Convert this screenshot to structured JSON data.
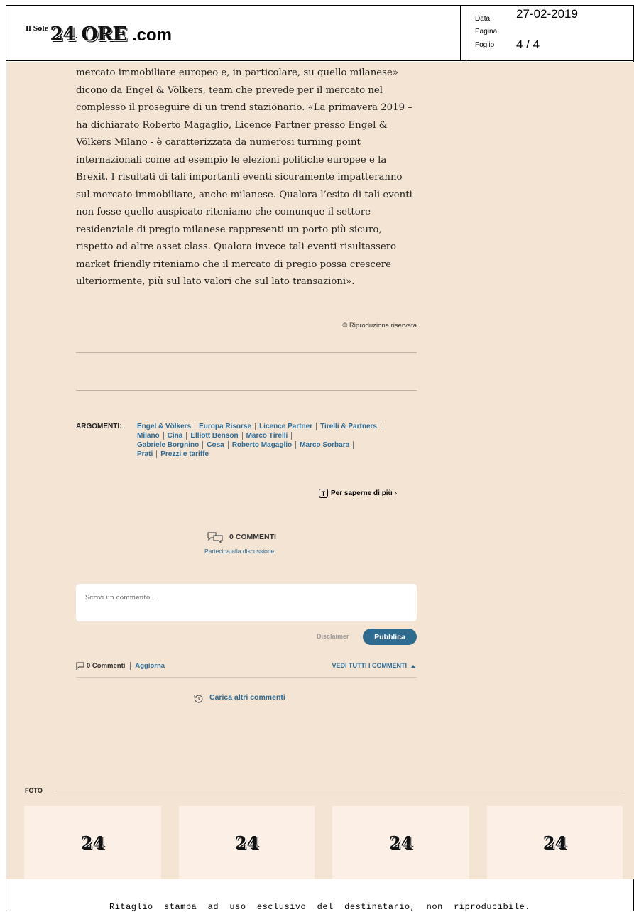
{
  "header": {
    "logo": {
      "small": "Il Sole",
      "main": "24 ORE",
      "suffix": ".com"
    },
    "meta": {
      "data_label": "Data",
      "data_value": "27-02-2019",
      "pagina_label": "Pagina",
      "foglio_label": "Foglio",
      "foglio_value": "4 / 4"
    }
  },
  "article": {
    "lines": [
      "mercato immobiliare europeo e, in particolare, su quello milanese»",
      "dicono da Engel & Völkers, team che prevede per il mercato nel",
      "complesso il proseguire di un trend stazionario. «La primavera 2019 –",
      "ha dichiarato Roberto Magaglio, Licence Partner presso Engel &",
      "Völkers Milano - è caratterizzata da numerosi turning point",
      "internazionali come ad esempio le elezioni politiche europee e la",
      "Brexit. I risultati di tali importanti eventi sicuramente impatteranno",
      "sul mercato immobiliare, anche milanese. Qualora l’esito di tali eventi",
      "non fosse quello auspicato riteniamo che comunque il settore",
      "residenziale di pregio milanese rappresenti un porto più sicuro,",
      "rispetto ad altre asset class. Qualora invece tali eventi risultassero",
      "market friendly riteniamo che il mercato di pregio possa crescere",
      "ulteriormente, più sul lato valori che sul lato transazioni»."
    ],
    "copyright": "© Riproduzione riservata"
  },
  "argomenti": {
    "label": "ARGOMENTI:",
    "tags": [
      "Engel & Völkers",
      "Europa Risorse",
      "Licence Partner",
      "Tirelli & Partners",
      "Milano",
      "Cina",
      "Elliott Benson",
      "Marco Tirelli",
      "Gabriele Borgnino",
      "Cosa",
      "Roberto Magaglio",
      "Marco Sorbara",
      "Prati",
      "Prezzi e tariffe"
    ]
  },
  "per_saperne": {
    "icon_letter": "T",
    "label": "Per saperne di più",
    "arrow": "›"
  },
  "comments": {
    "title": "0 COMMENTI",
    "subtitle": "Partecipa alla discussione",
    "placeholder": "Scrivi un commento...",
    "disclaimer": "Disclaimer",
    "publish": "Pubblica",
    "count": "0 Commenti",
    "refresh": "Aggiorna",
    "view_all": "VEDI TUTTI I COMMENTI",
    "load_more": "Carica altri commenti"
  },
  "foto": {
    "label": "FOTO",
    "thumb_logo": "24"
  },
  "footer": "Ritaglio  stampa  ad  uso  esclusivo  del  destinatario,  non  riproducibile."
}
